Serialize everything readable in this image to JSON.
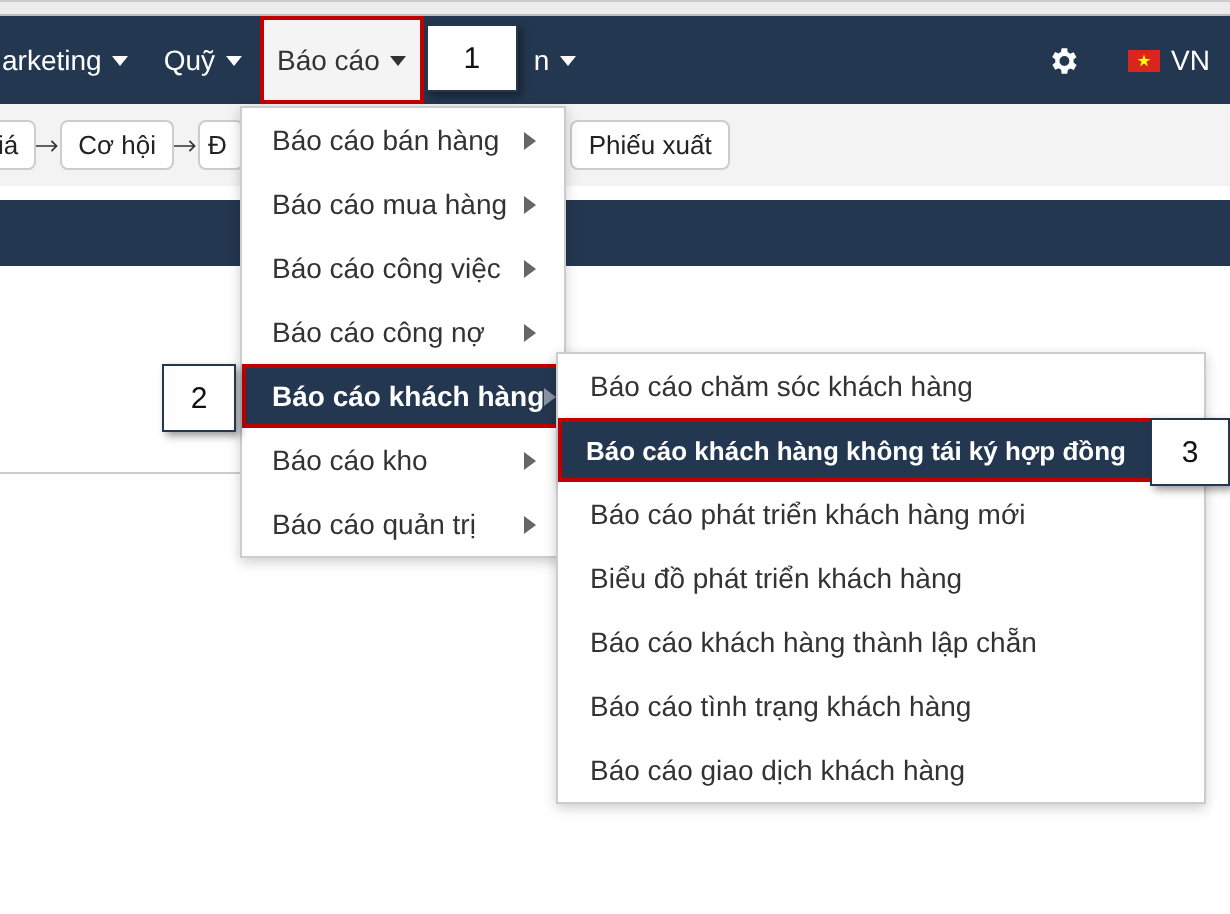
{
  "navbar": {
    "items": [
      {
        "label": "arketing",
        "selected": false,
        "highlighted": false
      },
      {
        "label": "Quỹ",
        "selected": false,
        "highlighted": false
      },
      {
        "label": "Báo cáo",
        "selected": true,
        "highlighted": true,
        "callout": "1"
      },
      {
        "label": "n",
        "selected": false,
        "highlighted": false
      }
    ],
    "language": "VN"
  },
  "toolbar": {
    "steps": [
      {
        "label": "iá"
      },
      {
        "label": "Cơ hội"
      },
      {
        "label": "Đ"
      },
      {
        "label": "Phiếu xuất"
      }
    ]
  },
  "menu": {
    "items": [
      {
        "label": "Báo cáo bán hàng",
        "selected": false,
        "highlighted": false
      },
      {
        "label": "Báo cáo mua hàng",
        "selected": false,
        "highlighted": false
      },
      {
        "label": "Báo cáo công việc",
        "selected": false,
        "highlighted": false
      },
      {
        "label": "Báo cáo công nợ",
        "selected": false,
        "highlighted": false
      },
      {
        "label": "Báo cáo khách hàng",
        "selected": true,
        "highlighted": true,
        "callout": "2"
      },
      {
        "label": "Báo cáo kho",
        "selected": false,
        "highlighted": false
      },
      {
        "label": "Báo cáo quản trị",
        "selected": false,
        "highlighted": false
      }
    ]
  },
  "submenu": {
    "items": [
      {
        "label": "Báo cáo chăm sóc khách hàng",
        "selected": false,
        "highlighted": false
      },
      {
        "label": "Báo cáo khách hàng không tái ký hợp đồng",
        "selected": true,
        "highlighted": true,
        "callout": "3"
      },
      {
        "label": "Báo cáo phát triển khách hàng mới",
        "selected": false,
        "highlighted": false
      },
      {
        "label": "Biểu đồ phát triển khách hàng",
        "selected": false,
        "highlighted": false
      },
      {
        "label": "Báo cáo khách hàng thành lập chẵn",
        "selected": false,
        "highlighted": false
      },
      {
        "label": "Báo cáo tình trạng khách hàng",
        "selected": false,
        "highlighted": false
      },
      {
        "label": "Báo cáo giao dịch khách hàng",
        "selected": false,
        "highlighted": false
      }
    ]
  }
}
